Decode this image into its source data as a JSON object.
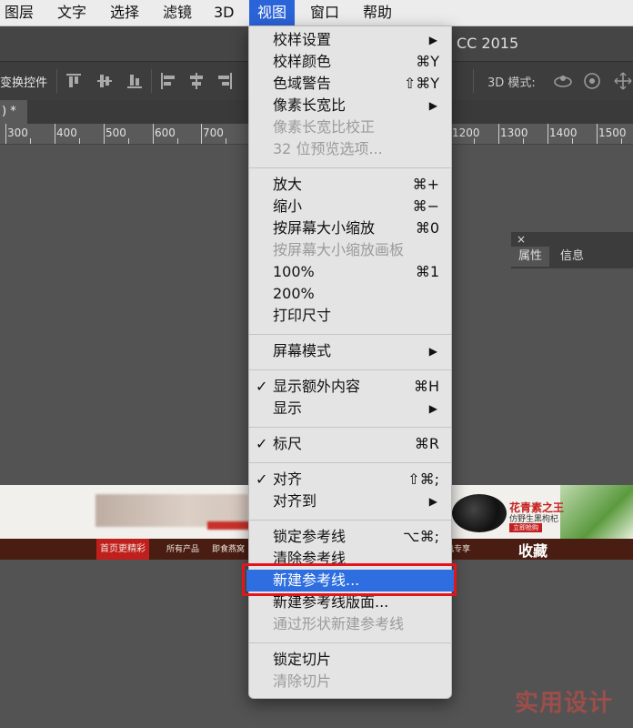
{
  "menubar": {
    "items": [
      "图层",
      "文字",
      "选择",
      "滤镜",
      "3D",
      "视图",
      "窗口",
      "帮助"
    ],
    "active": "视图"
  },
  "app": {
    "title_fragment": "CC 2015",
    "options_label": "变换控件",
    "mode_label": "3D 模式:",
    "tab_label": ") *"
  },
  "ruler": {
    "labels": [
      "300",
      "400",
      "500",
      "600",
      "700",
      "1200",
      "1300",
      "1400",
      "1500"
    ]
  },
  "panel": {
    "close": "×",
    "tabs": [
      "属性",
      "信息"
    ]
  },
  "banner": {
    "nav_items": [
      "首页更精彩",
      "所有产品",
      "即食燕窝",
      "机专享"
    ],
    "promo_title": "花青素之王",
    "promo_sub": "仿野生黑枸杞",
    "promo_btn": "立即抢购",
    "collect": "收藏"
  },
  "menu": {
    "items": [
      {
        "label": "校样设置",
        "arrow": "▶"
      },
      {
        "label": "校样颜色",
        "shortcut": "⌘Y"
      },
      {
        "label": "色域警告",
        "shortcut": "⇧⌘Y"
      },
      {
        "label": "像素长宽比",
        "arrow": "▶"
      },
      {
        "label": "像素长宽比校正",
        "disabled": true
      },
      {
        "label": "32 位预览选项...",
        "disabled": true
      },
      {
        "label": "放大",
        "shortcut": "⌘+"
      },
      {
        "label": "缩小",
        "shortcut": "⌘−"
      },
      {
        "label": "按屏幕大小缩放",
        "shortcut": "⌘0"
      },
      {
        "label": "按屏幕大小缩放画板",
        "disabled": true
      },
      {
        "label": "100%",
        "shortcut": "⌘1"
      },
      {
        "label": "200%"
      },
      {
        "label": "打印尺寸"
      },
      {
        "label": "屏幕模式",
        "arrow": "▶"
      },
      {
        "label": "显示额外内容",
        "shortcut": "⌘H",
        "checked": true
      },
      {
        "label": "显示",
        "arrow": "▶"
      },
      {
        "label": "标尺",
        "shortcut": "⌘R",
        "checked": true
      },
      {
        "label": "对齐",
        "shortcut": "⇧⌘;",
        "checked": true
      },
      {
        "label": "对齐到",
        "arrow": "▶"
      },
      {
        "label": "锁定参考线",
        "shortcut": "⌥⌘;"
      },
      {
        "label": "清除参考线"
      },
      {
        "label": "新建参考线...",
        "highlighted": true
      },
      {
        "label": "新建参考线版面..."
      },
      {
        "label": "通过形状新建参考线",
        "disabled": true
      },
      {
        "label": "锁定切片"
      },
      {
        "label": "清除切片",
        "disabled": true
      }
    ],
    "check_mark": "✓"
  },
  "watermark": "实用设计"
}
